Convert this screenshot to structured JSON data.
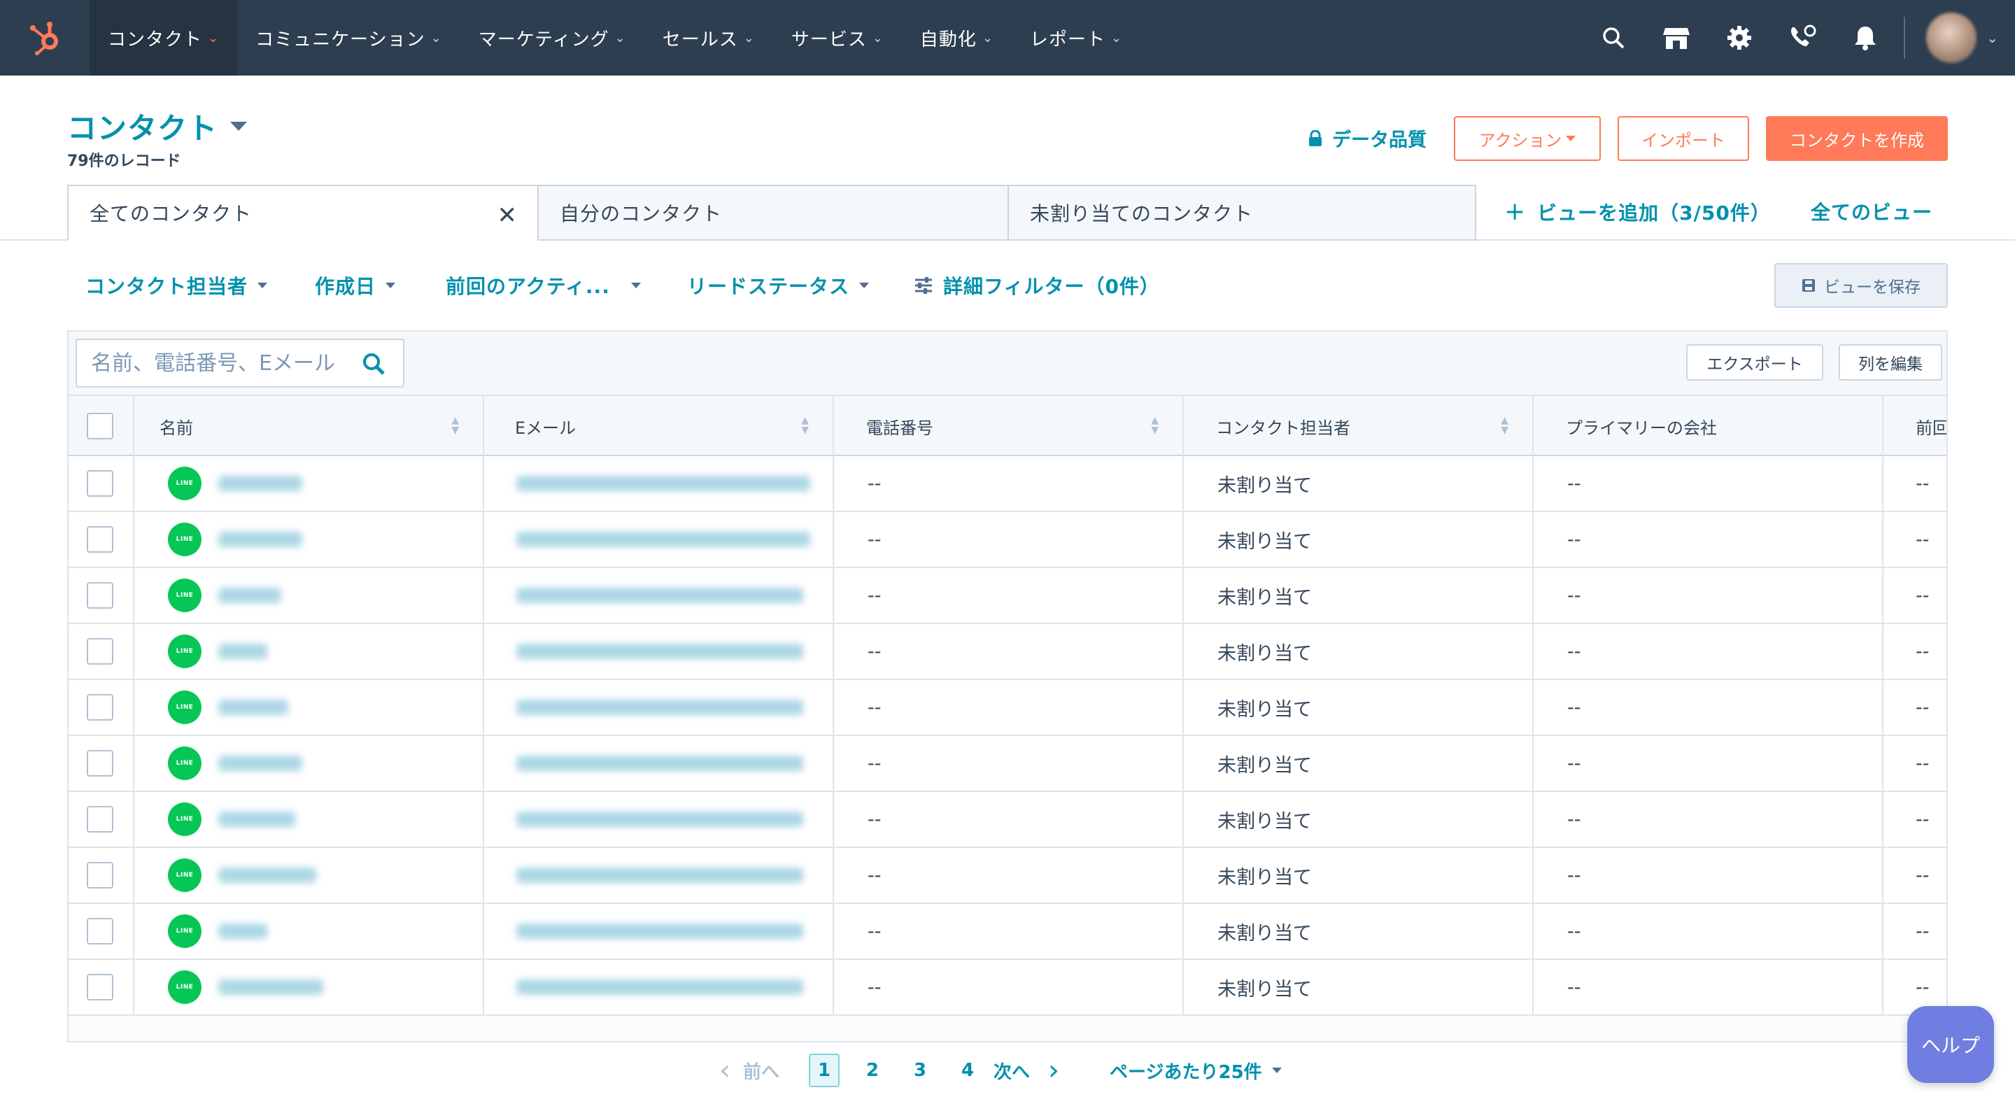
{
  "nav": {
    "items": [
      {
        "label": "コンタクト",
        "active": true
      },
      {
        "label": "コミュニケーション",
        "active": false
      },
      {
        "label": "マーケティング",
        "active": false
      },
      {
        "label": "セールス",
        "active": false
      },
      {
        "label": "サービス",
        "active": false
      },
      {
        "label": "自動化",
        "active": false
      },
      {
        "label": "レポート",
        "active": false
      }
    ],
    "icons": [
      "search-icon",
      "marketplace-icon",
      "settings-icon",
      "calling-icon",
      "notifications-icon"
    ]
  },
  "header": {
    "title": "コンタクト",
    "record_count": "79件のレコード",
    "data_quality": "データ品質",
    "actions_label": "アクション",
    "import_label": "インポート",
    "create_label": "コンタクトを作成"
  },
  "views": {
    "tabs": [
      "全てのコンタクト",
      "自分のコンタクト",
      "未割り当てのコンタクト"
    ],
    "add_view": "ビューを追加（3/50件）",
    "all_views": "全てのビュー"
  },
  "filters": {
    "owner": "コンタクト担当者",
    "created": "作成日",
    "last_activity": "前回のアクティ...",
    "lead_status": "リードステータス",
    "advanced": "詳細フィルター（0件）",
    "save_view": "ビューを保存"
  },
  "table": {
    "search_placeholder": "名前、電話番号、Eメール",
    "export_label": "エクスポート",
    "edit_columns_label": "列を編集",
    "columns": [
      "名前",
      "Eメール",
      "電話番号",
      "コンタクト担当者",
      "プライマリーの会社",
      "前回"
    ],
    "rows": [
      {
        "phone": "--",
        "owner": "未割り当て",
        "company": "--",
        "last": "--"
      },
      {
        "phone": "--",
        "owner": "未割り当て",
        "company": "--",
        "last": "--"
      },
      {
        "phone": "--",
        "owner": "未割り当て",
        "company": "--",
        "last": "--"
      },
      {
        "phone": "--",
        "owner": "未割り当て",
        "company": "--",
        "last": "--"
      },
      {
        "phone": "--",
        "owner": "未割り当て",
        "company": "--",
        "last": "--"
      },
      {
        "phone": "--",
        "owner": "未割り当て",
        "company": "--",
        "last": "--"
      },
      {
        "phone": "--",
        "owner": "未割り当て",
        "company": "--",
        "last": "--"
      },
      {
        "phone": "--",
        "owner": "未割り当て",
        "company": "--",
        "last": "--"
      },
      {
        "phone": "--",
        "owner": "未割り当て",
        "company": "--",
        "last": "--"
      },
      {
        "phone": "--",
        "owner": "未割り当て",
        "company": "--",
        "last": "--"
      }
    ],
    "line_badge": "LINE"
  },
  "pagination": {
    "prev": "前へ",
    "pages": [
      "1",
      "2",
      "3",
      "4"
    ],
    "current": "1",
    "next": "次へ",
    "per_page": "ページあたり25件"
  },
  "help": "ヘルプ",
  "colors": {
    "nav_bg": "#2d3e50",
    "link": "#0091ae",
    "accent": "#ff7a59",
    "line_green": "#06c755",
    "help": "#6f7ee0"
  }
}
